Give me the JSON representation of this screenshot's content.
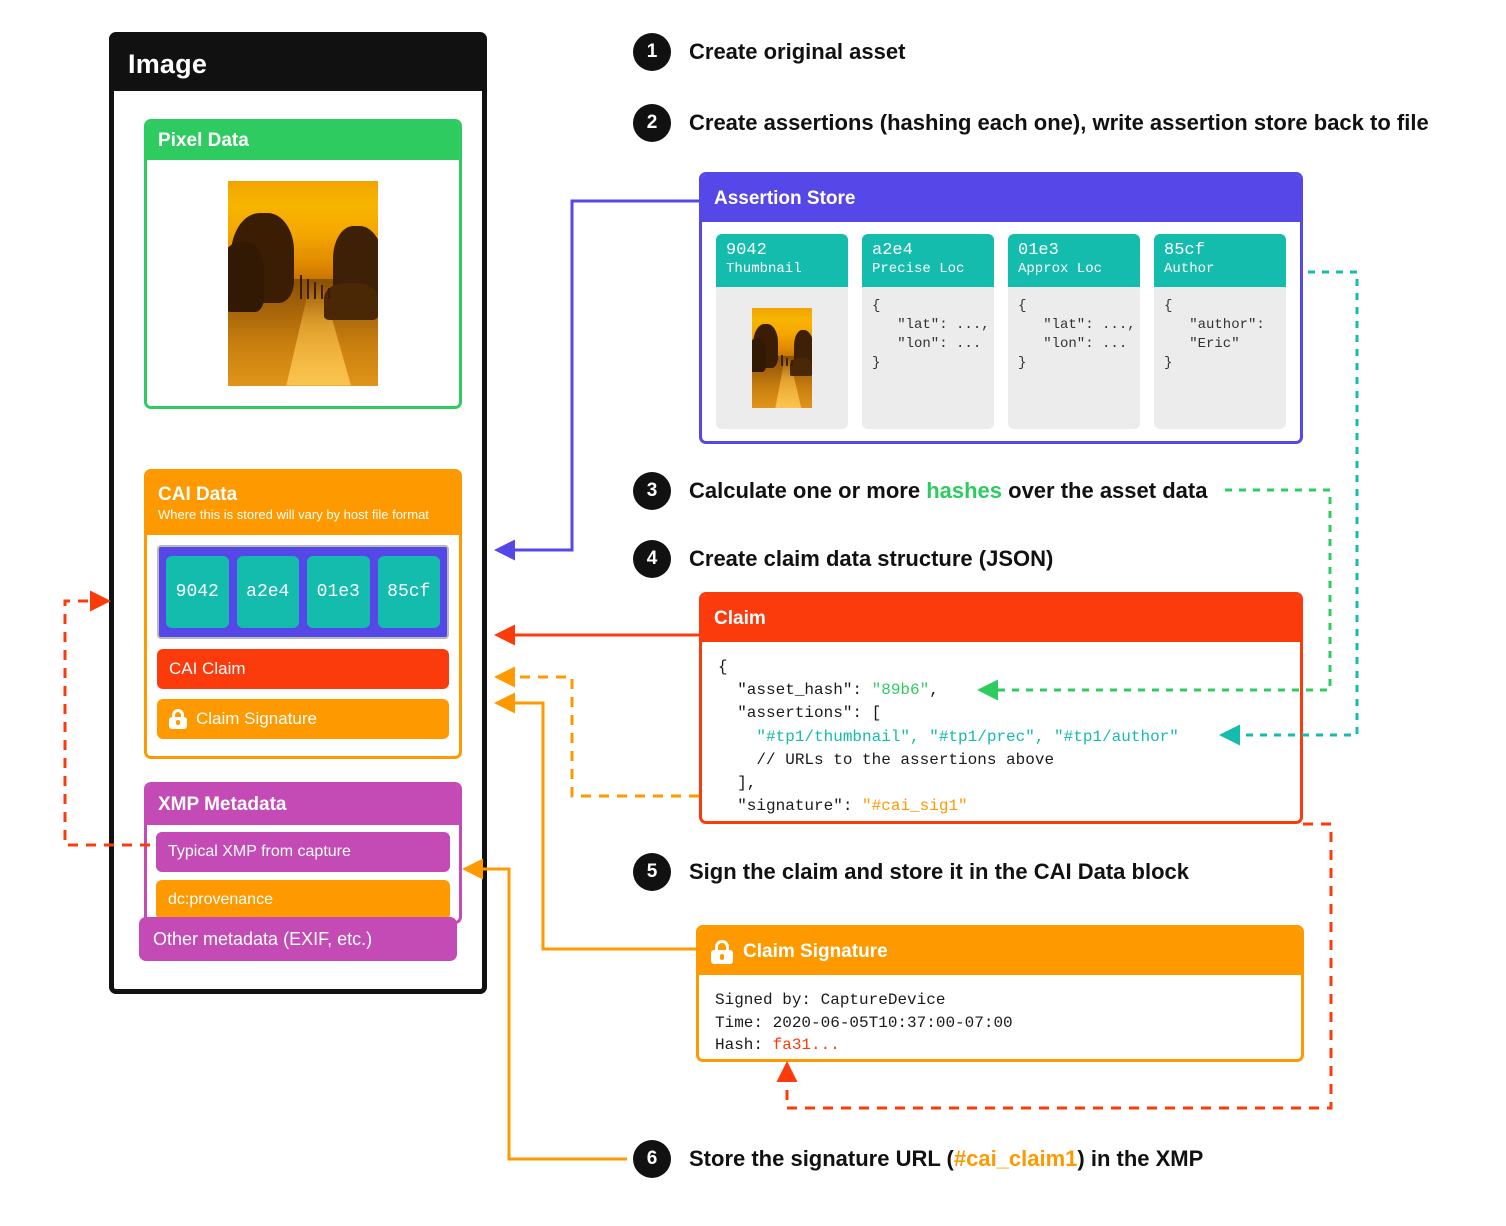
{
  "colors": {
    "green": "#2ECC60",
    "orange": "#FF9900",
    "magenta": "#C44BB5",
    "indigo": "#5547E8",
    "teal": "#13BCAC",
    "red": "#FB3B0C",
    "black": "#111111"
  },
  "image_window": {
    "title": "Image",
    "pixel_data": {
      "title": "Pixel Data",
      "thumbnail_alt": "sunset-road-photo"
    },
    "cai_data": {
      "title": "CAI Data",
      "subtitle": "Where this is stored will vary by host file format",
      "assertion_chips": [
        "9042",
        "a2e4",
        "01e3",
        "85cf"
      ],
      "cai_claim_label": "CAI Claim",
      "claim_signature_label": "Claim Signature"
    },
    "xmp": {
      "title": "XMP Metadata",
      "rows": [
        "Typical XMP from capture",
        "dc:provenance"
      ]
    },
    "other_metadata_label": "Other metadata (EXIF, etc.)"
  },
  "steps": [
    {
      "num": "1",
      "text": "Create original asset"
    },
    {
      "num": "2",
      "text": "Create assertions (hashing each one), write assertion store back to file"
    },
    {
      "num": "3",
      "pre": "Calculate one or more ",
      "highlight": "hashes",
      "post": " over the asset data"
    },
    {
      "num": "4",
      "text": "Create claim data structure (JSON)"
    },
    {
      "num": "5",
      "text": "Sign the claim and store it in the CAI Data block"
    },
    {
      "num": "6",
      "pre": "Store the signature URL (",
      "highlight": "#cai_claim1",
      "post": ") in the XMP"
    }
  ],
  "assertion_store": {
    "title": "Assertion Store",
    "cards": [
      {
        "id": "9042",
        "name": "Thumbnail",
        "body": "",
        "is_thumb": true
      },
      {
        "id": "a2e4",
        "name": "Precise Loc",
        "body": "{\n   \"lat\": ...,\n   \"lon\": ...\n}",
        "is_thumb": false
      },
      {
        "id": "01e3",
        "name": "Approx Loc",
        "body": "{\n   \"lat\": ...,\n   \"lon\": ...\n}",
        "is_thumb": false
      },
      {
        "id": "85cf",
        "name": "Author",
        "body": "{\n   \"author\":\n   \"Eric\"\n}",
        "is_thumb": false
      }
    ]
  },
  "claim": {
    "title": "Claim",
    "line_open": "{",
    "line_asset_key": "  \"asset_hash\": ",
    "line_asset_val": "\"89b6\"",
    "line_asset_comma": ",",
    "line_assertions_key": "  \"assertions\": [",
    "line_assertion_urls": "    \"#tp1/thumbnail\", \"#tp1/prec\", \"#tp1/author\"",
    "line_comment": "    // URLs to the assertions above",
    "line_close_arr": "  ],",
    "line_sig_key": "  \"signature\": ",
    "line_sig_val": "\"#cai_sig1\""
  },
  "claim_signature": {
    "title": "Claim Signature",
    "signed_by_label": "Signed by: ",
    "signed_by_value": "CaptureDevice",
    "time_label": "Time: ",
    "time_value": "2020-06-05T10:37:00-07:00",
    "hash_label": "Hash: ",
    "hash_value": "fa31..."
  }
}
